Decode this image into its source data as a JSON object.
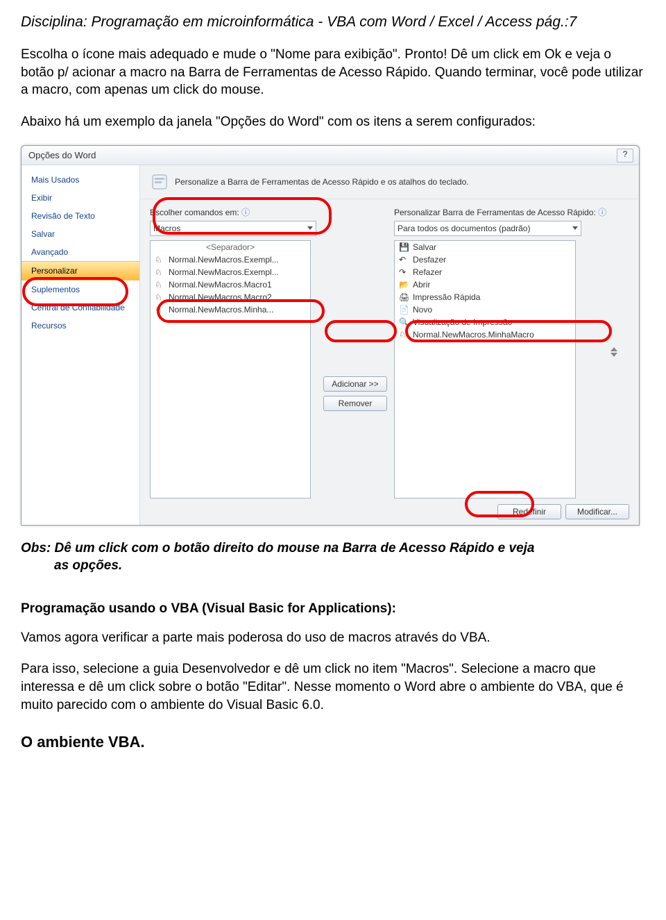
{
  "header": "Disciplina: Programação em microinformática  -  VBA com Word / Excel / Access   pág.:7",
  "p1": "Escolha o ícone mais adequado e mude o \"Nome para exibição\". Pronto! Dê um click em Ok e veja o botão p/ acionar a macro na Barra de Ferramentas de Acesso Rápido. Quando terminar, você pode utilizar a macro, com apenas um click do mouse.",
  "p2": "Abaixo há um exemplo da janela \"Opções do Word\" com os itens a serem configurados:",
  "dialog": {
    "title": "Opções do Word",
    "help": "?",
    "sidebar": [
      "Mais Usados",
      "Exibir",
      "Revisão de Texto",
      "Salvar",
      "Avançado",
      "Personalizar",
      "Suplementos",
      "Central de Confiabilidade",
      "Recursos"
    ],
    "main_head": "Personalize a Barra de Ferramentas de Acesso Rápido e os atalhos do teclado.",
    "left": {
      "label": "Escolher comandos em:",
      "dropdown": "Macros",
      "items": [
        "<Separador>",
        "Normal.NewMacros.Exempl...",
        "Normal.NewMacros.Exempl...",
        "Normal.NewMacros.Macro1",
        "Normal.NewMacros.Macro2",
        "Normal.NewMacros.Minha..."
      ]
    },
    "right": {
      "label": "Personalizar Barra de Ferramentas de Acesso Rápido:",
      "dropdown": "Para todos os documentos (padrão)",
      "items": [
        "Salvar",
        "Desfazer",
        "Refazer",
        "Abrir",
        "Impressão Rápida",
        "Novo",
        "Visualização de Impressão",
        "Normal.NewMacros.MinhaMacro"
      ]
    },
    "mid": {
      "add": "Adicionar >>",
      "remove": "Remover"
    },
    "bottom": {
      "reset": "Redefinir",
      "modify": "Modificar..."
    }
  },
  "obs_lead": "Obs: Dê um click com o botão direito do mouse na Barra de Acesso Rápido e veja",
  "obs_rest": "as opções.",
  "sec_title": "Programação usando o VBA (Visual Basic for Applications):",
  "p3": "Vamos agora verificar a parte mais poderosa do uso de macros através do VBA.",
  "p4": "Para isso, selecione a guia Desenvolvedor e dê um click no item \"Macros\". Selecione a macro que interessa e dê um click sobre o botão \"Editar\". Nesse momento o Word abre o ambiente do VBA, que é muito parecido com o ambiente do Visual Basic 6.0.",
  "last_heading": "O ambiente VBA."
}
